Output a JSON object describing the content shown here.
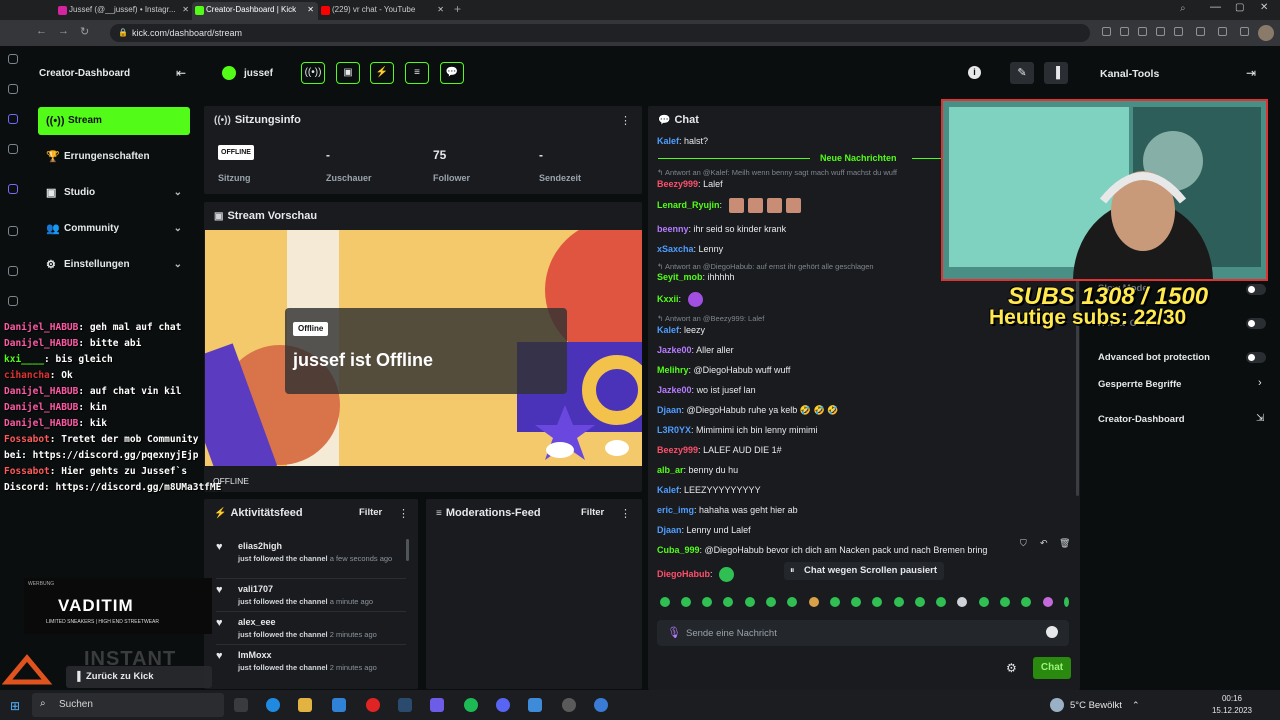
{
  "tabs": [
    {
      "label": "Jussef (@__jussef) • Instagr...",
      "active": false,
      "color": "#d6249f"
    },
    {
      "label": "Creator-Dashboard | Kick",
      "active": true,
      "color": "#53fc18"
    },
    {
      "label": "(229) vr chat - YouTube",
      "active": false,
      "color": "#ff0000"
    }
  ],
  "address": {
    "url": "kick.com/dashboard/stream"
  },
  "sidebar": {
    "title": "Creator-Dashboard",
    "items": [
      {
        "label": "Stream",
        "active": true,
        "icon": "broadcast-icon"
      },
      {
        "label": "Errungenschaften",
        "icon": "trophy-icon"
      },
      {
        "label": "Studio",
        "icon": "studio-icon",
        "expandable": true
      },
      {
        "label": "Community",
        "icon": "community-icon",
        "expandable": true
      },
      {
        "label": "Einstellungen",
        "icon": "gear-icon",
        "expandable": true
      }
    ]
  },
  "topbar": {
    "username": "jussef",
    "right_title": "Kanal-Tools"
  },
  "session": {
    "title": "Sitzungsinfo",
    "badge": "OFFLINE",
    "stats": [
      {
        "value": "",
        "label": "Sitzung"
      },
      {
        "value": "-",
        "label": "Zuschauer"
      },
      {
        "value": "75",
        "label": "Follower"
      },
      {
        "value": "-",
        "label": "Sendezeit"
      }
    ]
  },
  "preview": {
    "title": "Stream Vorschau",
    "badge": "Offline",
    "message": "jussef ist Offline",
    "status": "OFFLINE"
  },
  "activity": {
    "title": "Aktivitätsfeed",
    "filter": "Filter",
    "items": [
      {
        "name": "elias2high",
        "text": "just followed the channel",
        "time": "a few seconds ago"
      },
      {
        "name": "vali1707",
        "text": "just followed the channel",
        "time": "a minute ago"
      },
      {
        "name": "alex_eee",
        "text": "just followed the channel",
        "time": "2 minutes ago"
      },
      {
        "name": "ImMoxx",
        "text": "just followed the channel",
        "time": "2 minutes ago"
      }
    ]
  },
  "moderation": {
    "title": "Moderations-Feed",
    "filter": "Filter"
  },
  "chat": {
    "title": "Chat",
    "new_messages": "Neue Nachrichten",
    "paused": "Chat wegen Scrollen pausiert",
    "placeholder": "Sende eine Nachricht",
    "send": "Chat",
    "messages": [
      {
        "user": "Kalef",
        "color": "#4f9dff",
        "text": "halst?"
      },
      {
        "reply": "Antwort an @Kalef: Meilh wenn benny sagt mach wuff machst du wuff"
      },
      {
        "user": "Beezy999",
        "color": "#ff4f6b",
        "text": "Lalef"
      },
      {
        "user": "Lenard_Ryujin",
        "color": "#53fc18",
        "text": ""
      },
      {
        "user": "beenny",
        "color": "#b67cff",
        "text": "ihr seid so kinder krank"
      },
      {
        "user": "xSaxcha",
        "color": "#4f9dff",
        "text": "Lenny"
      },
      {
        "reply": "Antwort an @DiegoHabub: auf ernst ihr gehört alle geschlagen"
      },
      {
        "user": "Seyit_mob",
        "color": "#53fc18",
        "text": "ihhhhh"
      },
      {
        "user": "Kxxii",
        "color": "#53fc18",
        "text": ""
      },
      {
        "reply": "Antwort an @Beezy999: Lalef"
      },
      {
        "user": "Kalef",
        "color": "#4f9dff",
        "text": "leezy"
      },
      {
        "user": "Jazke00",
        "color": "#b67cff",
        "text": "Aller aller"
      },
      {
        "user": "Melihry",
        "color": "#53fc18",
        "text": "@DiegoHabub wuff wuff"
      },
      {
        "user": "Jazke00",
        "color": "#b67cff",
        "text": "wo ist jusef lan"
      },
      {
        "user": "Djaan",
        "color": "#4f9dff",
        "text": "@DiegoHabub ruhe ya kelb 🤣 🤣 🤣"
      },
      {
        "user": "L3R0YX",
        "color": "#4f9dff",
        "text": "Mimimimi ich bin lenny mimimi"
      },
      {
        "user": "Beezy999",
        "color": "#ff4f6b",
        "text": "LALEF AUD DIE 1#"
      },
      {
        "user": "alb_ar",
        "color": "#53fc18",
        "text": "benny du hu"
      },
      {
        "user": "Kalef",
        "color": "#4f9dff",
        "text": "LEEZYYYYYYYYY"
      },
      {
        "user": "eric_img",
        "color": "#4f9dff",
        "text": "hahaha was geht hier ab"
      },
      {
        "user": "Djaan",
        "color": "#4f9dff",
        "text": "Lenny und Lalef"
      },
      {
        "user": "Cuba_999",
        "color": "#53fc18",
        "text": "@DiegoHabub bevor ich dich am Nacken pack und nach Bremen bring"
      },
      {
        "user": "DiegoHabub",
        "color": "#ff4f6b",
        "text": ""
      }
    ]
  },
  "overlay": {
    "counter": "SUBS 1308 / 1500",
    "today": "Heutige subs: 22/30",
    "lines": [
      {
        "user": "Danijel_HABUB",
        "text": "geh mal auf chat"
      },
      {
        "user": "Danijel_HABUB",
        "text": "bitte abi"
      },
      {
        "user": "kxi____",
        "text": "bis gleich"
      },
      {
        "user": "cihancha",
        "text": "Ok"
      },
      {
        "user": "Danijel_HABUB",
        "text": "auf chat vin kil"
      },
      {
        "user": "Danijel_HABUB",
        "text": "kin"
      },
      {
        "user": "Danijel_HABUB",
        "text": "kik"
      },
      {
        "user": "Fossabot",
        "text": "Tretet der mob Community"
      },
      {
        "user": "",
        "text": "bei: https://discord.gg/pqexnyjEjp"
      },
      {
        "user": "Fossabot",
        "text": "Hier gehts zu Jussef`s"
      },
      {
        "user": "",
        "text": "Discord: https://discord.gg/m8UMa3tfME"
      }
    ],
    "sponsor_top": "WERBUNG",
    "sponsor_name": "VADITIM",
    "sponsor_tagline": "LIMITED SNEAKERS | HIGH END STREETWEAR",
    "instant": "INSTANT",
    "back_to_kick": "Zurück zu Kick"
  },
  "channel_tools": {
    "items": [
      {
        "label": "Advanced bot protection",
        "toggle": true
      },
      {
        "label": "Gesperrte Begriffe",
        "chevron": true
      },
      {
        "label": "Creator-Dashboard",
        "chevron": true
      }
    ]
  },
  "taskbar": {
    "search": "Suchen",
    "weather": "5°C Bewölkt",
    "time": "00:16",
    "date": "15.12.2023"
  },
  "colors": {
    "accent": "#53fc18",
    "panel": "#191b1f",
    "bg": "#0b0e0f"
  }
}
